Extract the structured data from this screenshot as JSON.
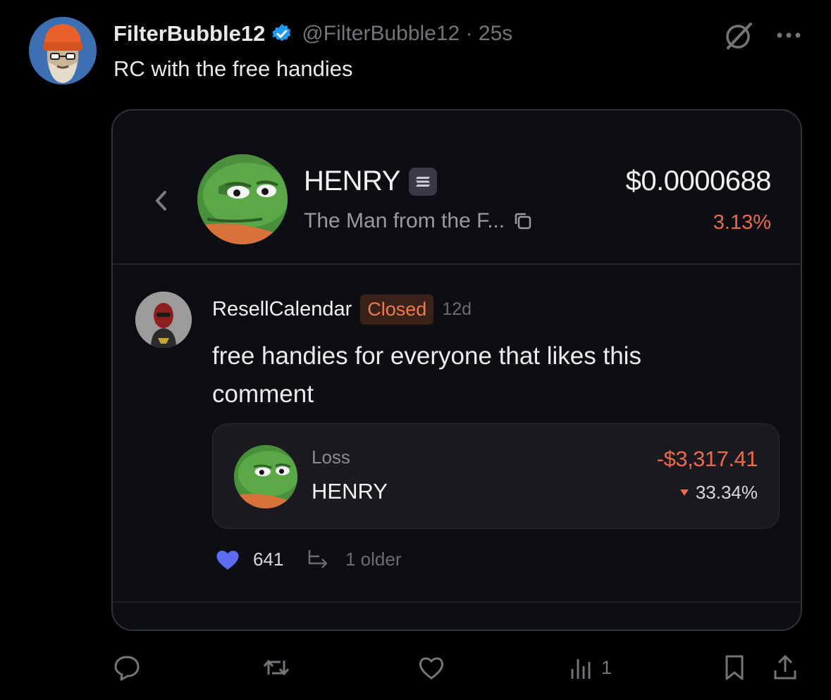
{
  "tweet": {
    "author_name": "FilterBubble12",
    "handle": "@FilterBubble12",
    "separator": "·",
    "time": "25s",
    "text": "RC with the free handies",
    "verified_color": "#1d9bf0"
  },
  "embedded": {
    "token": {
      "name": "HENRY",
      "description": "The Man from the F...",
      "price": "$0.0000688",
      "change": "3.13%"
    },
    "comment": {
      "author": "ResellCalendar",
      "status_badge": "Closed",
      "age": "12d",
      "text": "free handies for everyone that likes this comment"
    },
    "trade": {
      "label": "Loss",
      "token": "HENRY",
      "amount": "-$3,317.41",
      "percent": "33.34%"
    },
    "likes": "641",
    "older": "1 older"
  },
  "actions": {
    "views": "1"
  },
  "colors": {
    "loss": "#ea6a4d",
    "like_heart": "#5b6cf0",
    "background": "#000000"
  },
  "icons": [
    "grok-icon",
    "more-icon",
    "back-icon",
    "menu-icon",
    "copy-icon",
    "heart-icon",
    "reply-tree-icon",
    "reply-icon",
    "retweet-icon",
    "like-icon",
    "views-icon",
    "bookmark-icon",
    "share-icon"
  ]
}
